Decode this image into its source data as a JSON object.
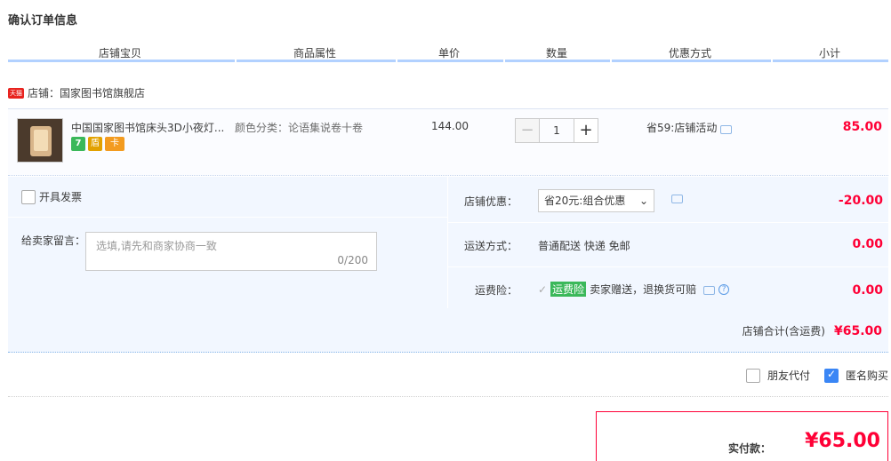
{
  "title": "确认订单信息",
  "columns": [
    "店铺宝贝",
    "商品属性",
    "单价",
    "数量",
    "优惠方式",
    "小计"
  ],
  "shop": {
    "badge": "天猫",
    "label": "店铺：国家图书馆旗舰店"
  },
  "item": {
    "name": "中国国家图书馆床头3D小夜灯...",
    "attribute": "颜色分类：论语集说卷十卷",
    "price": "144.00",
    "qty_minus": "−",
    "qty": "1",
    "qty_plus": "+",
    "promotion": "省59:店铺活动",
    "subtotal": "85.00",
    "badges": [
      "7",
      "盾",
      "卡"
    ]
  },
  "invoice_label": "开具发票",
  "message": {
    "label": "给卖家留言：",
    "placeholder": "选填,请先和商家协商一致",
    "count": "0/200"
  },
  "shop_discount": {
    "label": "店铺优惠：",
    "selected": "省20元:组合优惠",
    "amount": "-20.00"
  },
  "shipping": {
    "label": "运送方式：",
    "value": "普通配送 快递 免邮",
    "amount": "0.00"
  },
  "insurance": {
    "label": "运费险：",
    "tag": "运费险",
    "text": "卖家赠送，退换货可赔",
    "amount": "0.00"
  },
  "shop_total": {
    "label": "店铺合计(含运费)",
    "amount": "¥65.00"
  },
  "options": {
    "friend_pay": "朋友代付",
    "anonymous": "匿名购买"
  },
  "payment": {
    "label": "实付款：",
    "amount": "¥65.00"
  },
  "colors": {
    "accent": "#ff0036",
    "header_line": "#b2d1ff",
    "panel_bg": "#f2f7ff"
  }
}
